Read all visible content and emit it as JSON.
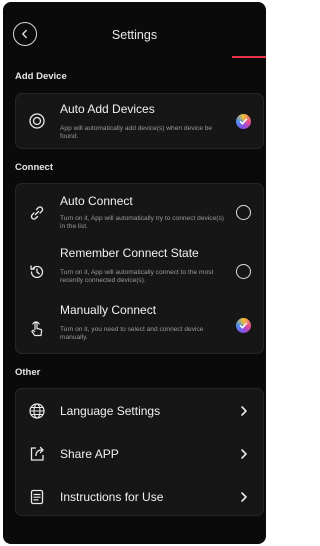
{
  "header": {
    "title": "Settings"
  },
  "sections": {
    "add_device": "Add Device",
    "connect": "Connect",
    "other": "Other"
  },
  "add_device": {
    "auto_add": {
      "name": "Auto Add Devices",
      "desc": "App will automatically add device(s) when device be found.",
      "checked": true
    }
  },
  "connect": {
    "auto_connect": {
      "name": "Auto Connect",
      "desc": "Turn on it, App will automatically try to connect device(s) in the list.",
      "checked": false
    },
    "remember_state": {
      "name": "Remember Connect State",
      "desc": "Turn on it, App will automatically connect to the most recently connected device(s).",
      "checked": false
    },
    "manual": {
      "name": "Manually Connect",
      "desc": "Turn on it, you need to select and connect device manually.",
      "checked": true
    }
  },
  "other": {
    "language": {
      "name": "Language Settings",
      "icon": "globe-icon"
    },
    "share": {
      "name": "Share APP",
      "icon": "share-icon"
    },
    "instructions": {
      "name": "Instructions for Use",
      "icon": "document-icon"
    }
  },
  "colors": {
    "accent": "#e8344a",
    "background": "#0a0a0a",
    "card": "#161616"
  }
}
